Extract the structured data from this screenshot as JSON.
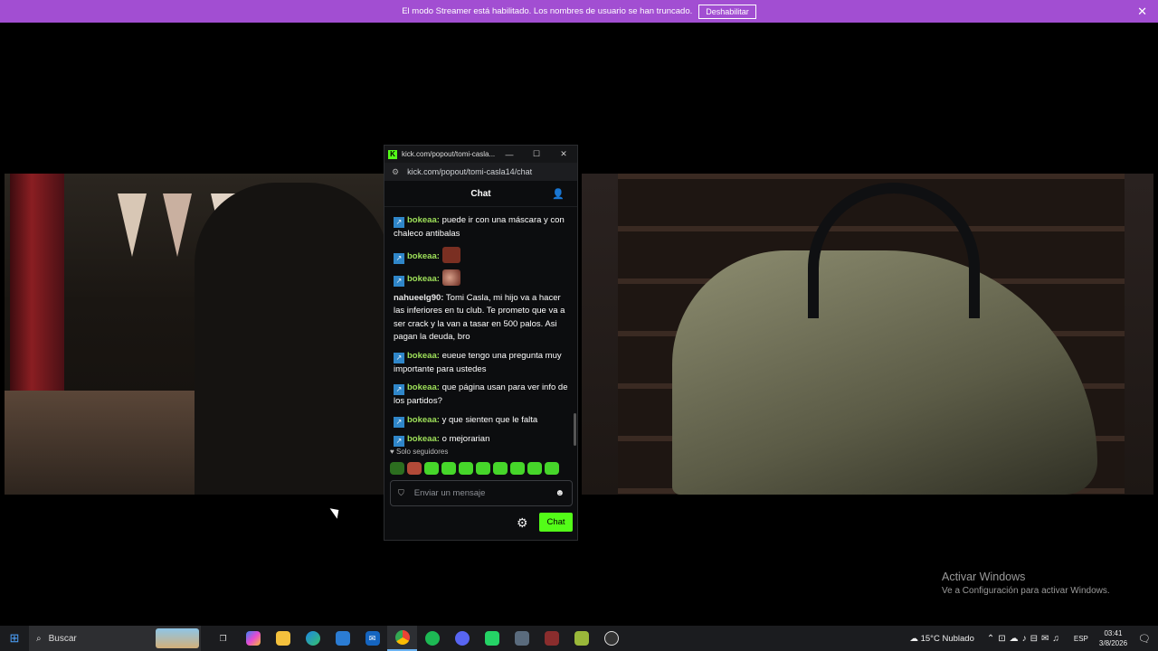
{
  "banner": {
    "message": "El modo Streamer está habilitado. Los nombres de usuario se han truncado.",
    "button_label": "Deshabilitar",
    "close_glyph": "✕"
  },
  "popout": {
    "window_title": "kick.com/popout/tomi-casla...",
    "url": "kick.com/popout/tomi-casla14/chat",
    "header_title": "Chat",
    "messages": [
      {
        "user": "bokeaa",
        "text": "puede ir con una máscara y con chaleco antibalas",
        "badge": true
      },
      {
        "user": "bokeaa",
        "text": "",
        "badge": true,
        "emote": "face-emote"
      },
      {
        "user": "bokeaa",
        "text": "",
        "badge": true,
        "emote": "tongue-emote"
      },
      {
        "user": "nahueelg90",
        "text": "Tomi Casla, mi hijo va a hacer las inferiores en tu club. Te prometo que va a ser crack y la van a tasar en 500 palos. Asi pagan la deuda, bro",
        "badge": false
      },
      {
        "user": "bokeaa",
        "text": "eueue tengo una pregunta muy importante para ustedes",
        "badge": true
      },
      {
        "user": "bokeaa",
        "text": "que página usan para ver info de los partidos?",
        "badge": true
      },
      {
        "user": "bokeaa",
        "text": "y que sienten que le falta",
        "badge": true
      },
      {
        "user": "bokeaa",
        "text": "o mejorarian",
        "badge": true
      }
    ],
    "followers_only": "Solo seguidores",
    "input_placeholder": "Enviar un mensaje",
    "send_label": "Chat",
    "accent": "#53fc18"
  },
  "watermark": {
    "line1": "Activar Windows",
    "line2": "Ve a Configuración para activar Windows."
  },
  "taskbar": {
    "search_label": "Buscar",
    "weather": "15°C  Nublado",
    "language": "ESP",
    "time": "03:41",
    "date": "3/8/2026"
  }
}
